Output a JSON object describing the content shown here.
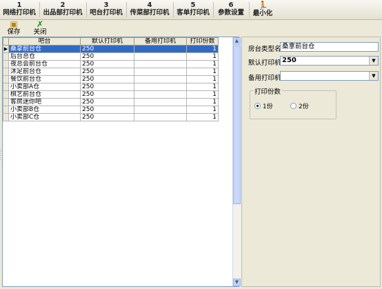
{
  "tabs": [
    {
      "num": "1",
      "label": "网络打印机"
    },
    {
      "num": "2",
      "label": "出品部打印机"
    },
    {
      "num": "3",
      "label": "吧台打印机"
    },
    {
      "num": "4",
      "label": "传菜部打印机"
    },
    {
      "num": "5",
      "label": "客单打印机"
    },
    {
      "num": "6",
      "label": "参数设置"
    },
    {
      "num": "",
      "label": "最小化",
      "icon": "running-person-icon"
    }
  ],
  "toolbar": {
    "save_label": "保存",
    "close_label": "关闭"
  },
  "grid": {
    "columns": [
      "吧台",
      "默认打印机",
      "备用打印机",
      "打印份数"
    ],
    "rows": [
      {
        "name": "桑拿前台仓",
        "default": "250",
        "backup": "",
        "copies": "1"
      },
      {
        "name": "后台总仓",
        "default": "250",
        "backup": "",
        "copies": "1"
      },
      {
        "name": "夜总会前台仓",
        "default": "250",
        "backup": "",
        "copies": "1"
      },
      {
        "name": "沐足前台仓",
        "default": "250",
        "backup": "",
        "copies": "1"
      },
      {
        "name": "餐饮前台仓",
        "default": "250",
        "backup": "",
        "copies": "1"
      },
      {
        "name": "小卖部A仓",
        "default": "250",
        "backup": "",
        "copies": "1"
      },
      {
        "name": "棋艺前台仓",
        "default": "250",
        "backup": "",
        "copies": "1"
      },
      {
        "name": "客房迷你吧",
        "default": "250",
        "backup": "",
        "copies": "1"
      },
      {
        "name": "小卖部B仓",
        "default": "250",
        "backup": "",
        "copies": "1"
      },
      {
        "name": "小卖部C仓",
        "default": "250",
        "backup": "",
        "copies": "1"
      }
    ]
  },
  "detail": {
    "type_label": "房台类型名",
    "type_value": "桑拿前台仓",
    "default_printer_label": "默认打印机",
    "default_printer_value": "250",
    "backup_printer_label": "备用打印机",
    "backup_printer_value": "",
    "copies_group_label": "打印份数",
    "copies_options": [
      "1份",
      "2份"
    ],
    "copies_selected": "1份"
  },
  "colors": {
    "selection": "#316ac5",
    "window": "#ece9d8"
  }
}
